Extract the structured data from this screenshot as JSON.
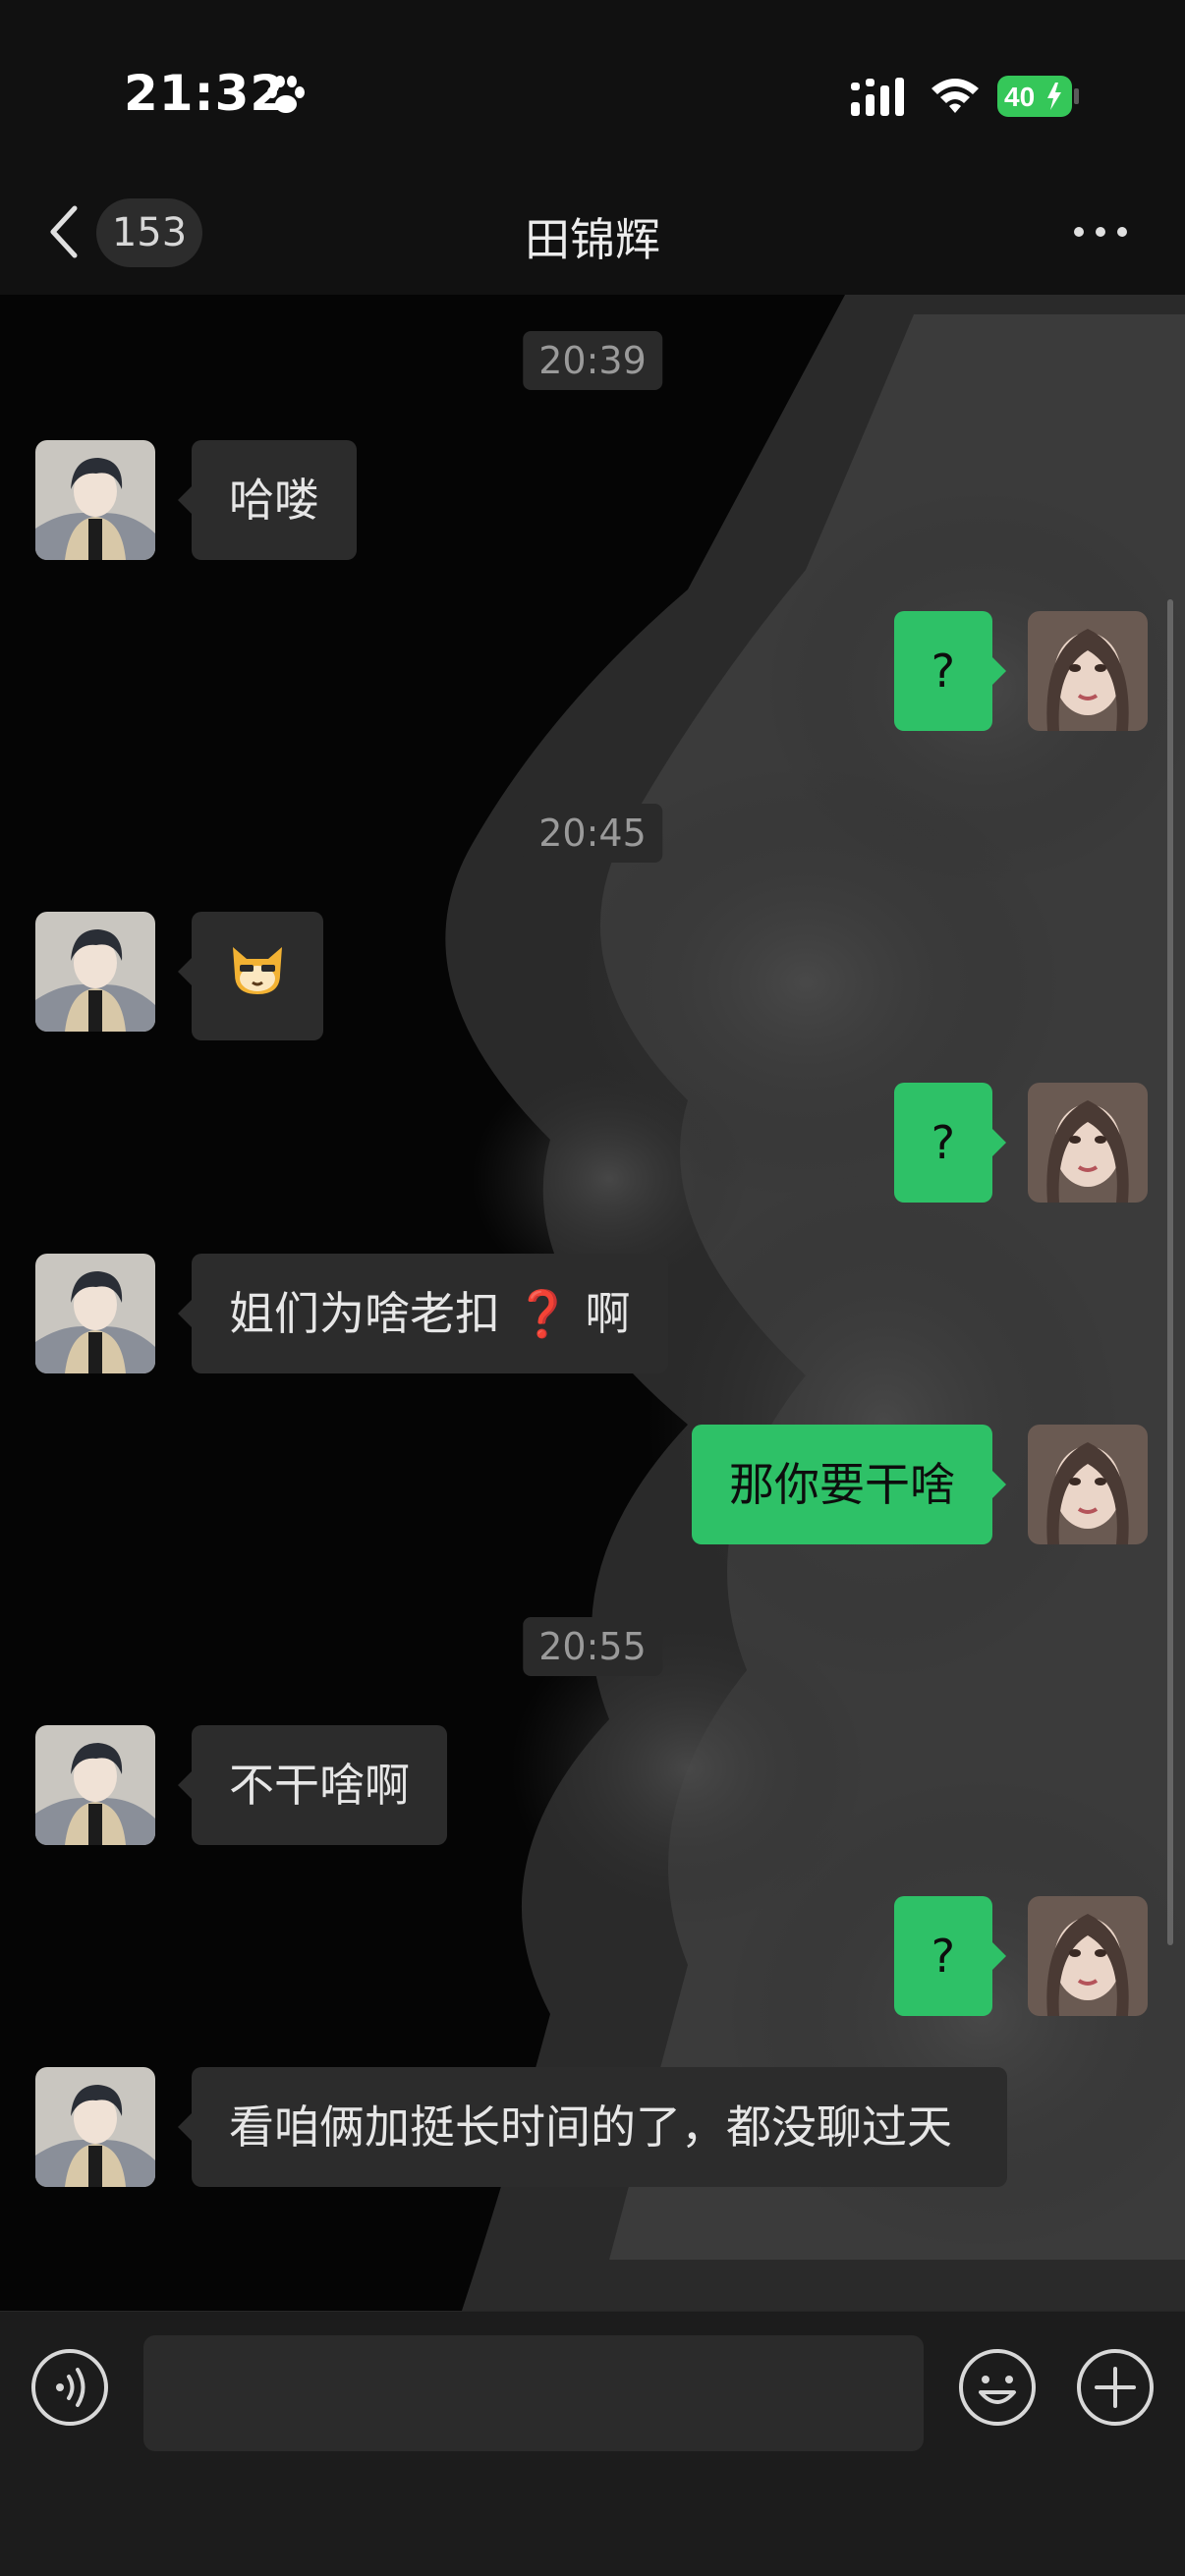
{
  "status_bar": {
    "time": "21:32",
    "battery_level": "40",
    "icons": [
      "paw-icon",
      "signal-icon",
      "wifi-icon",
      "battery-icon"
    ]
  },
  "nav": {
    "unread_count": "153",
    "title": "田锦辉",
    "icons": [
      "back-icon",
      "more-icon"
    ]
  },
  "messages": {
    "ts1": "20:39",
    "m1": "哈喽",
    "m2": "?",
    "ts2": "20:45",
    "m3_emoji": "🐱",
    "m4": "?",
    "m5_before": "姐们为啥老扣",
    "m5_after": "啊",
    "m5_icon": "❓",
    "m6": "那你要干啥",
    "ts3": "20:55",
    "m7": "不干啥啊",
    "m8": "?",
    "m9": "看咱俩加挺长时间的了，都没聊过天"
  },
  "input_bar": {
    "input_value": "",
    "icons": [
      "voice-icon",
      "emoji-icon",
      "plus-icon"
    ]
  },
  "colors": {
    "outgoing_bubble": "#2ec167",
    "incoming_bubble": "#2c2c2c",
    "background": "#111111"
  }
}
